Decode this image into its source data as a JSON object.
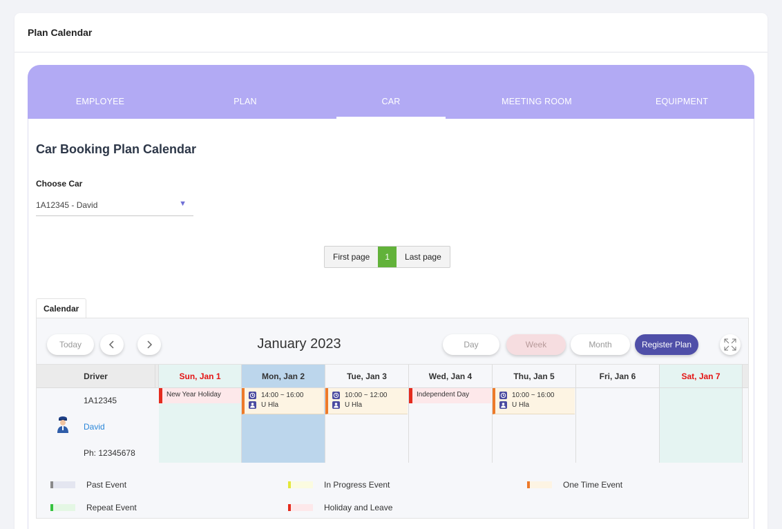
{
  "page": {
    "title": "Plan Calendar"
  },
  "tabs": [
    {
      "label": "EMPLOYEE"
    },
    {
      "label": "PLAN"
    },
    {
      "label": "CAR"
    },
    {
      "label": "MEETING ROOM"
    },
    {
      "label": "EQUIPMENT"
    }
  ],
  "active_tab": "CAR",
  "section": {
    "title": "Car Booking Plan Calendar",
    "choose_label": "Choose Car",
    "car_selected": "1A12345 - David"
  },
  "pager": {
    "first": "First page",
    "current": "1",
    "last": "Last page"
  },
  "calendar": {
    "tab_label": "Calendar",
    "today_label": "Today",
    "title": "January 2023",
    "day_label": "Day",
    "week_label": "Week",
    "month_label": "Month",
    "register_label": "Register Plan",
    "driver_header": "Driver",
    "days": [
      "Sun, Jan 1",
      "Mon, Jan 2",
      "Tue, Jan 3",
      "Wed, Jan 4",
      "Thu, Jan 5",
      "Fri, Jan 6",
      "Sat, Jan 7"
    ],
    "driver": {
      "car": "1A12345",
      "name": "David",
      "phone": "Ph: 12345678"
    },
    "events": {
      "sun": "New Year Holiday",
      "mon_time": "14:00 ~ 16:00",
      "mon_person": "U Hla",
      "tue_time": "10:00 ~ 12:00",
      "tue_person": "U Hla",
      "wed": "Independent Day",
      "thu_time": "10:00 ~ 16:00",
      "thu_person": "U Hla"
    }
  },
  "legend": [
    {
      "label": "Past Event",
      "marker": "#8a8a8a",
      "fill": "#e4e6f0"
    },
    {
      "label": "In Progress Event",
      "marker": "#e3e83a",
      "fill": "#fbfbe0"
    },
    {
      "label": "One Time Event",
      "marker": "#ed7a2a",
      "fill": "#fdf4e3"
    },
    {
      "label": "Repeat Event",
      "marker": "#35c23f",
      "fill": "#e4f7e4"
    },
    {
      "label": "Holiday and Leave",
      "marker": "#e42b1e",
      "fill": "#fde8ea"
    }
  ],
  "colors": {
    "tabbar": "#b2aaf4",
    "weekend_bg": "#e5f4f2",
    "today_bg": "#bcd6ec",
    "weekday_bg": "#f6f7fa",
    "register": "#4f4fa8"
  }
}
